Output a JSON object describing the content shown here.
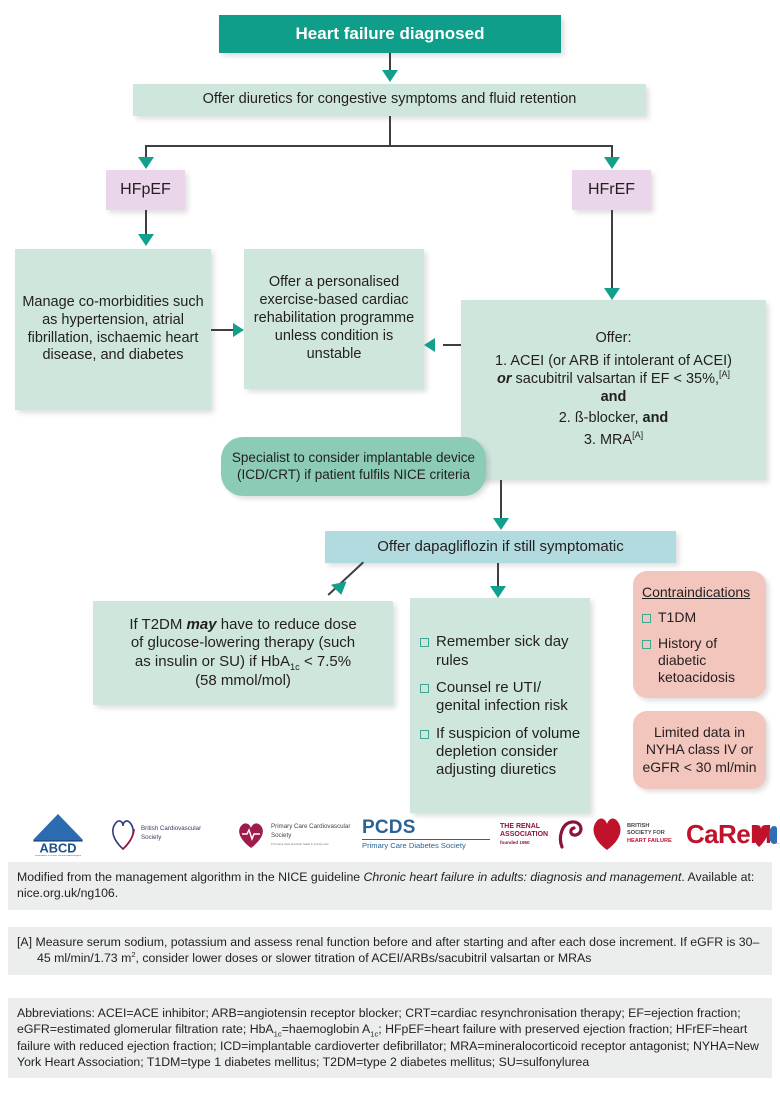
{
  "colors": {
    "header_teal": "#0f9e8a",
    "pale_teal": "#cfe6dc",
    "mid_teal": "#8ccbb5",
    "pale_blue": "#b2dbe0",
    "lavender": "#ead5ea",
    "pink": "#f3c6bd",
    "arrow": "#12a08c",
    "line": "#3f3f3f",
    "footnote_bg": "#eceded"
  },
  "flow": {
    "header": "Heart failure diagnosed",
    "diuretics": "Offer diuretics for congestive symptoms and fluid retention",
    "hfpef": "HFpEF",
    "hfref": "HFrEF",
    "manage_comorbidities": "Manage co-morbidities such as hypertension, atrial fibrillation, ischaemic heart disease, and diabetes",
    "rehab": "Offer a personalised exercise-based cardiac rehabilitation programme unless condition is unstable",
    "offer": {
      "title": "Offer:",
      "item1_a": "1. ACEI (or ARB if intolerant of ACEI)",
      "item1_b_italic": "or",
      "item1_b": " sacubitril valsartan if EF < 35%,",
      "item1_sup": "[A]",
      "and1": "and",
      "item2_a": "2. ",
      "item2_b": "ß-blocker, ",
      "item2_bold": "and",
      "item3": "3. MRA",
      "item3_sup": "[A]"
    },
    "specialist": "Specialist to consider implantable device (ICD/CRT) if patient fulfils NICE criteria",
    "dapagliflozin": "Offer dapagliflozin if still symptomatic",
    "t2dm": {
      "l1_a": "If T2DM ",
      "l1_italic": "may",
      "l1_b": " have to reduce dose",
      "l2": "of glucose-lowering therapy (such",
      "l3_a": "as insulin or SU) if HbA",
      "l3_sub": "1c",
      "l3_b": " < 7.5%",
      "l4": "(58 mmol/mol)"
    },
    "advice_items": [
      "Remember sick day rules",
      "Counsel re UTI/ genital infection risk",
      "If suspicion of volume depletion consider adjusting diuretics"
    ],
    "contraindications": {
      "title": "Contraindications",
      "items": [
        "T1DM",
        "History of diabetic ketoacidosis"
      ]
    },
    "limited_data": "Limited data in NYHA class IV or eGFR < 30 ml/min"
  },
  "logos": [
    {
      "name": "abcd-logo",
      "main": "ABCD",
      "sub": "Association of British Clinical Diabetologists"
    },
    {
      "name": "british-cardiovascular-society-logo",
      "main": "British Cardiovascular Society",
      "sub": ""
    },
    {
      "name": "primary-care-cardiovascular-society-logo",
      "main": "Primary Care Cardiovascular Society",
      "sub": "Promoting heart and brain health in primary care"
    },
    {
      "name": "pcds-logo",
      "main": "PCDS",
      "sub": "Primary Care Diabetes Society"
    },
    {
      "name": "renal-association-logo",
      "main": "THE RENAL ASSOCIATION",
      "sub": "founded 1950"
    },
    {
      "name": "british-society-for-heart-failure-logo",
      "main": "BRITISH SOCIETY FOR",
      "sub": "HEART FAILURE"
    },
    {
      "name": "careme-uk-logo",
      "main": "CaReMeUK",
      "sub": ""
    }
  ],
  "footnotes": {
    "source_a": "Modified from the management algorithm in the NICE guideline ",
    "source_italic": "Chronic heart failure in adults: diagnosis and management",
    "source_b": ". Available at: nice.org.uk/ng106.",
    "note_a_marker": "[A]",
    "note_a_1": " Measure serum sodium, potassium and assess renal function before and after starting and after each dose increment. If eGFR is 30–45 ml/min/1.73 m",
    "note_a_sup": "2",
    "note_a_2": ", consider lower doses or slower titration of ACEI/ARBs/sacubitril valsartan or MRAs",
    "abbrev_label": "Abbreviations: ",
    "abbrev_1": "ACEI=ACE inhibitor; ARB=angiotensin receptor blocker; CRT=cardiac resynchronisation therapy; EF=ejection fraction; eGFR=estimated glomerular filtration rate; HbA",
    "abbrev_sub1": "1c",
    "abbrev_2": "=haemoglobin A",
    "abbrev_sub2": "1c",
    "abbrev_3": "; HFpEF=heart failure with preserved ejection fraction; HFrEF=heart failure with reduced ejection fraction; ICD=implantable cardioverter defibrillator; MRA=mineralocorticoid receptor antagonist; NYHA=New York Heart Association; T1DM=type 1 diabetes mellitus; T2DM=type 2 diabetes mellitus; SU=sulfonylurea"
  }
}
